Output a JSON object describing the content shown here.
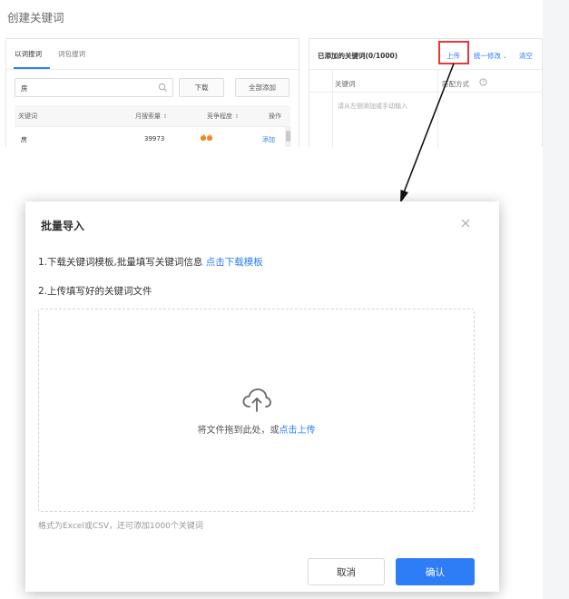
{
  "page": {
    "title": "创建关键词"
  },
  "left_panel": {
    "tabs": [
      "以词搜词",
      "词包搜词"
    ],
    "search_value": "房",
    "download_label": "下载",
    "add_all_label": "全部添加",
    "columns": [
      "关键词",
      "月搜索量",
      "竞争程度",
      "操作"
    ],
    "rows": [
      {
        "keyword": "房",
        "volume": "39973",
        "competition_level": 2,
        "action": "添加"
      }
    ]
  },
  "right_panel": {
    "title": "已添加的关键词(0/1000)",
    "upload_label": "上传",
    "batch_edit_label": "统一修改",
    "clear_label": "清空",
    "col_keyword": "关键词",
    "col_match": "匹配方式",
    "placeholder": "请从左侧添加或手动输入"
  },
  "modal": {
    "title": "批量导入",
    "step1_text": "1.下载关键词模板,批量填写关键词信息",
    "step1_link": "点击下载模板",
    "step2_text": "2.上传填写好的关键词文件",
    "drop_text": "将文件拖到此处，或",
    "drop_link": "点击上传",
    "hint": "格式为Excel或CSV，还可添加1000个关键词",
    "cancel_label": "取消",
    "confirm_label": "确认"
  },
  "colors": {
    "accent": "#2d7df6",
    "highlight": "#e53935",
    "fire": "#f5841f"
  }
}
